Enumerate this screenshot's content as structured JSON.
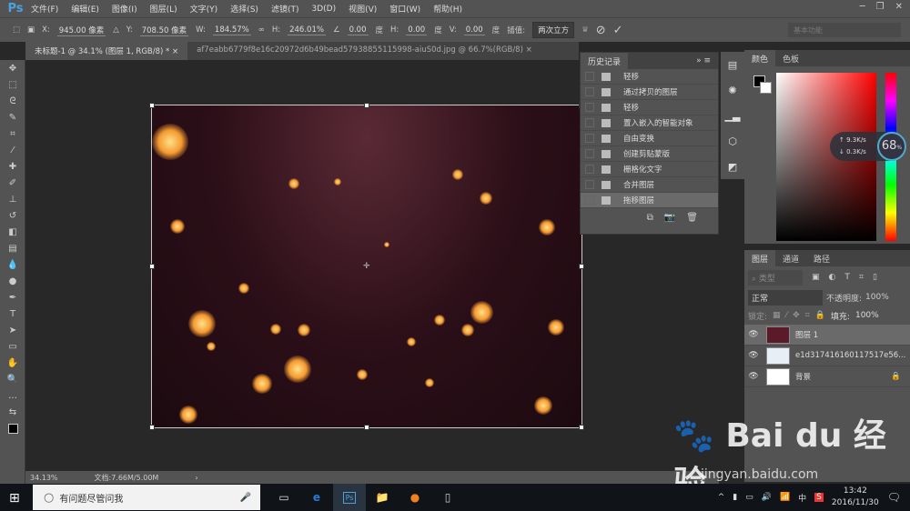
{
  "app": {
    "logo": "Ps"
  },
  "menu": [
    "文件(F)",
    "编辑(E)",
    "图像(I)",
    "图层(L)",
    "文字(Y)",
    "选择(S)",
    "滤镜(T)",
    "3D(D)",
    "视图(V)",
    "窗口(W)",
    "帮助(H)"
  ],
  "options": {
    "x_label": "X:",
    "x": "945.00 像素",
    "y_label": "Y:",
    "y": "708.50 像素",
    "w_label": "W:",
    "w": "184.57%",
    "h_label": "H:",
    "h": "246.01%",
    "angle": "0.00",
    "deg": "度",
    "hskew_label": "H:",
    "hskew": "0.00",
    "vskew_label": "V:",
    "vskew": "0.00",
    "interp_label": "插值:",
    "interp": "两次立方",
    "workspace": "基本功能"
  },
  "tabs": [
    {
      "label": "未标题-1 @ 34.1% (图层 1, RGB/8) *"
    },
    {
      "label": "af7eabb6779f8e16c20972d6b49bead57938855115998-aiuS0d.jpg @ 66.7%(RGB/8)"
    }
  ],
  "history": {
    "title": "历史记录",
    "items": [
      "轻移",
      "通过拷贝的图层",
      "轻移",
      "置入嵌入的智能对象",
      "自由变换",
      "创建剪贴蒙版",
      "栅格化文字",
      "合并图层",
      "拖移图层"
    ]
  },
  "color": {
    "tabs": [
      "颜色",
      "色板"
    ],
    "gauge": {
      "up": "9.3K/s",
      "down": "0.3K/s",
      "percent": "68",
      "unit": "%"
    }
  },
  "layers": {
    "tabs": [
      "图层",
      "通道",
      "路径"
    ],
    "filter": "类型",
    "blend": "正常",
    "opacity_label": "不透明度:",
    "opacity": "100%",
    "lock_label": "锁定:",
    "fill_label": "填充:",
    "fill": "100%",
    "items": [
      {
        "name": "图层 1"
      },
      {
        "name": "e1d317416160117517e56..."
      },
      {
        "name": "背景"
      }
    ]
  },
  "status": {
    "zoom": "34.13%",
    "doc": "文档:7.66M/5.00M"
  },
  "taskbar": {
    "search": "有问题尽管问我",
    "time": "13:42",
    "date": "2016/11/30",
    "ime": "中"
  },
  "watermark": {
    "brand": "Bai du 经验",
    "url": "jingyan.baidu.com"
  }
}
